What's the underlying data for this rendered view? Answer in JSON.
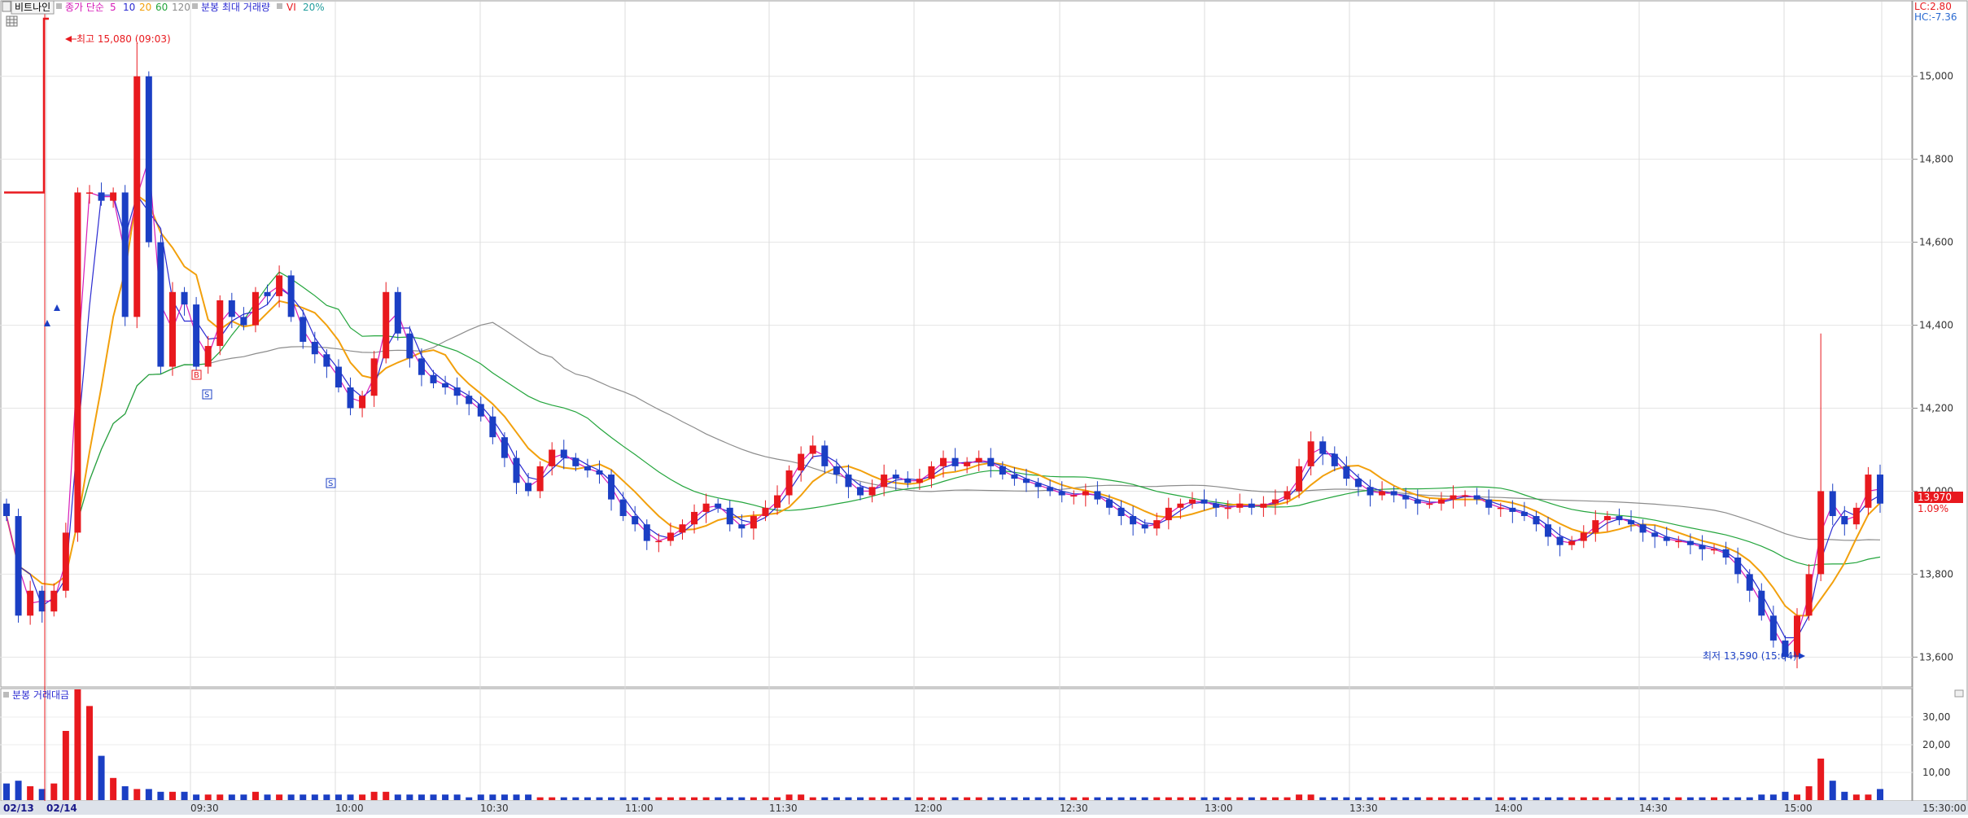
{
  "header": {
    "stock_name": "비트나인",
    "legend_ma": "종가 단순",
    "ma_periods": [
      "5",
      "10",
      "20",
      "60",
      "120"
    ],
    "legend_max_volume": "분봉 최대 거래량",
    "legend_vi": "VI",
    "legend_vi_pct": "20%"
  },
  "right_labels": {
    "lc": "LC:2.80",
    "hc": "HC:-7.36"
  },
  "price_tag": {
    "value": "13,970",
    "pct": "1.09%"
  },
  "annotations": {
    "high": "최고 15,080 (09:03)",
    "low": "최저 13,590 (15:04)"
  },
  "volume_pane": {
    "title": "분봉 거래대금"
  },
  "colors": {
    "up": "#e8191e",
    "down": "#1b3fc4",
    "ma5": "#d61bb8",
    "ma10": "#2a2ad1",
    "ma20": "#f2a00c",
    "ma60": "#23a53c",
    "ma120": "#8c8c8c",
    "vi": "#e8191e",
    "vi_pct": "#239e9e"
  },
  "chart_data": {
    "type": "candlestick",
    "price_axis": {
      "ticks": [
        "15,000",
        "14,800",
        "14,600",
        "14,400",
        "14,200",
        "14,000",
        "13,800",
        "13,600"
      ],
      "ylim": [
        13530,
        15180
      ]
    },
    "volume_axis": {
      "ticks": [
        "30,00",
        "20,00",
        "10,00"
      ],
      "ylim": [
        0,
        40
      ]
    },
    "time_axis": {
      "labels": [
        "02/13",
        "02/14",
        "09:30",
        "10:00",
        "10:30",
        "11:00",
        "11:30",
        "12:00",
        "12:30",
        "13:00",
        "13:30",
        "14:00",
        "14:30",
        "15:00",
        "15:30:00"
      ]
    },
    "previous_day_close": 14720,
    "high": 15080,
    "low": 13590,
    "last": 13970,
    "closes_approx": [
      13940,
      13700,
      13760,
      13710,
      13760,
      13900,
      14720,
      14720,
      14700,
      14720,
      14420,
      15000,
      14600,
      14300,
      14480,
      14450,
      14300,
      14350,
      14460,
      14420,
      14400,
      14480,
      14470,
      14520,
      14420,
      14360,
      14330,
      14300,
      14250,
      14200,
      14230,
      14320,
      14480,
      14380,
      14320,
      14280,
      14260,
      14250,
      14230,
      14210,
      14180,
      14130,
      14080,
      14020,
      14000,
      14060,
      14100,
      14080,
      14060,
      14050,
      14040,
      13980,
      13940,
      13920,
      13880,
      13880,
      13900,
      13920,
      13950,
      13970,
      13960,
      13920,
      13910,
      13940,
      13960,
      13990,
      14050,
      14090,
      14110,
      14060,
      14040,
      14010,
      13990,
      14010,
      14040,
      14030,
      14020,
      14030,
      14060,
      14080,
      14060,
      14070,
      14080,
      14060,
      14040,
      14030,
      14020,
      14010,
      14000,
      13990,
      13990,
      14000,
      13980,
      13960,
      13940,
      13920,
      13910,
      13930,
      13960,
      13970,
      13980,
      13970,
      13960,
      13960,
      13970,
      13960,
      13970,
      13980,
      14000,
      14060,
      14120,
      14090,
      14060,
      14030,
      14010,
      13990,
      14000,
      13990,
      13980,
      13970,
      13970,
      13980,
      13990,
      13990,
      13980,
      13960,
      13960,
      13950,
      13940,
      13920,
      13890,
      13870,
      13880,
      13900,
      13930,
      13940,
      13930,
      13920,
      13900,
      13890,
      13880,
      13880,
      13870,
      13860,
      13860,
      13840,
      13800,
      13760,
      13700,
      13640,
      13600,
      13700,
      13800,
      14000,
      13940,
      13920,
      13960,
      14040,
      13970
    ],
    "volume_approx": [
      6,
      7,
      5,
      4,
      6,
      25,
      40,
      34,
      16,
      8,
      5,
      4,
      4,
      3,
      3,
      3,
      2,
      2,
      2,
      2,
      2,
      3,
      2,
      2,
      2,
      2,
      2,
      2,
      2,
      2,
      2,
      3,
      3,
      2,
      2,
      2,
      2,
      2,
      2,
      1,
      2,
      2,
      2,
      2,
      2,
      1,
      1,
      1,
      1,
      1,
      1,
      1,
      1,
      1,
      1,
      1,
      1,
      1,
      1,
      1,
      1,
      1,
      1,
      1,
      1,
      1,
      2,
      2,
      1,
      1,
      1,
      1,
      1,
      1,
      1,
      1,
      1,
      1,
      1,
      1,
      1,
      1,
      1,
      1,
      1,
      1,
      1,
      1,
      1,
      1,
      1,
      1,
      1,
      1,
      1,
      1,
      1,
      1,
      1,
      1,
      1,
      1,
      1,
      1,
      1,
      1,
      1,
      1,
      1,
      2,
      2,
      1,
      1,
      1,
      1,
      1,
      1,
      1,
      1,
      1,
      1,
      1,
      1,
      1,
      1,
      1,
      1,
      1,
      1,
      1,
      1,
      1,
      1,
      1,
      1,
      1,
      1,
      1,
      1,
      1,
      1,
      1,
      1,
      1,
      1,
      1,
      1,
      1,
      2,
      2,
      3,
      2,
      5,
      15,
      7,
      3,
      2,
      2,
      4
    ]
  }
}
